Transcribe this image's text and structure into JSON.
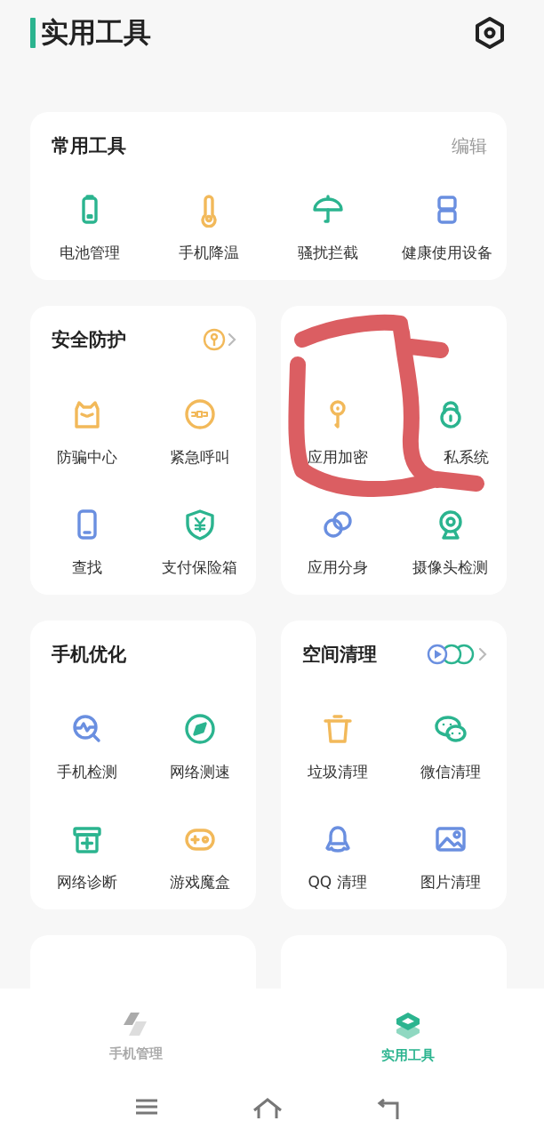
{
  "header": {
    "title": "实用工具"
  },
  "common_tools": {
    "title": "常用工具",
    "edit": "编辑",
    "items": [
      {
        "label": "电池管理"
      },
      {
        "label": "手机降温"
      },
      {
        "label": "骚扰拦截"
      },
      {
        "label": "健康使用设备"
      }
    ]
  },
  "sections": [
    {
      "title": "安全防护",
      "items": [
        {
          "label": "防骗中心"
        },
        {
          "label": "紧急呼叫"
        },
        {
          "label": "查找"
        },
        {
          "label": "支付保险箱"
        }
      ]
    },
    {
      "items": [
        {
          "label": "应用加密"
        },
        {
          "label": "私系统",
          "kind": "partly_hidden"
        },
        {
          "label": "应用分身"
        },
        {
          "label": "摄像头检测"
        }
      ]
    },
    {
      "title": "手机优化",
      "items": [
        {
          "label": "手机检测"
        },
        {
          "label": "网络测速"
        },
        {
          "label": "网络诊断"
        },
        {
          "label": "游戏魔盒"
        }
      ]
    },
    {
      "title": "空间清理",
      "items": [
        {
          "label": "垃圾清理"
        },
        {
          "label": "微信清理"
        },
        {
          "label": "QQ 清理"
        },
        {
          "label": "图片清理"
        }
      ]
    }
  ],
  "tabs": [
    {
      "label": "手机管理",
      "selected": false
    },
    {
      "label": "实用工具",
      "selected": true
    }
  ]
}
